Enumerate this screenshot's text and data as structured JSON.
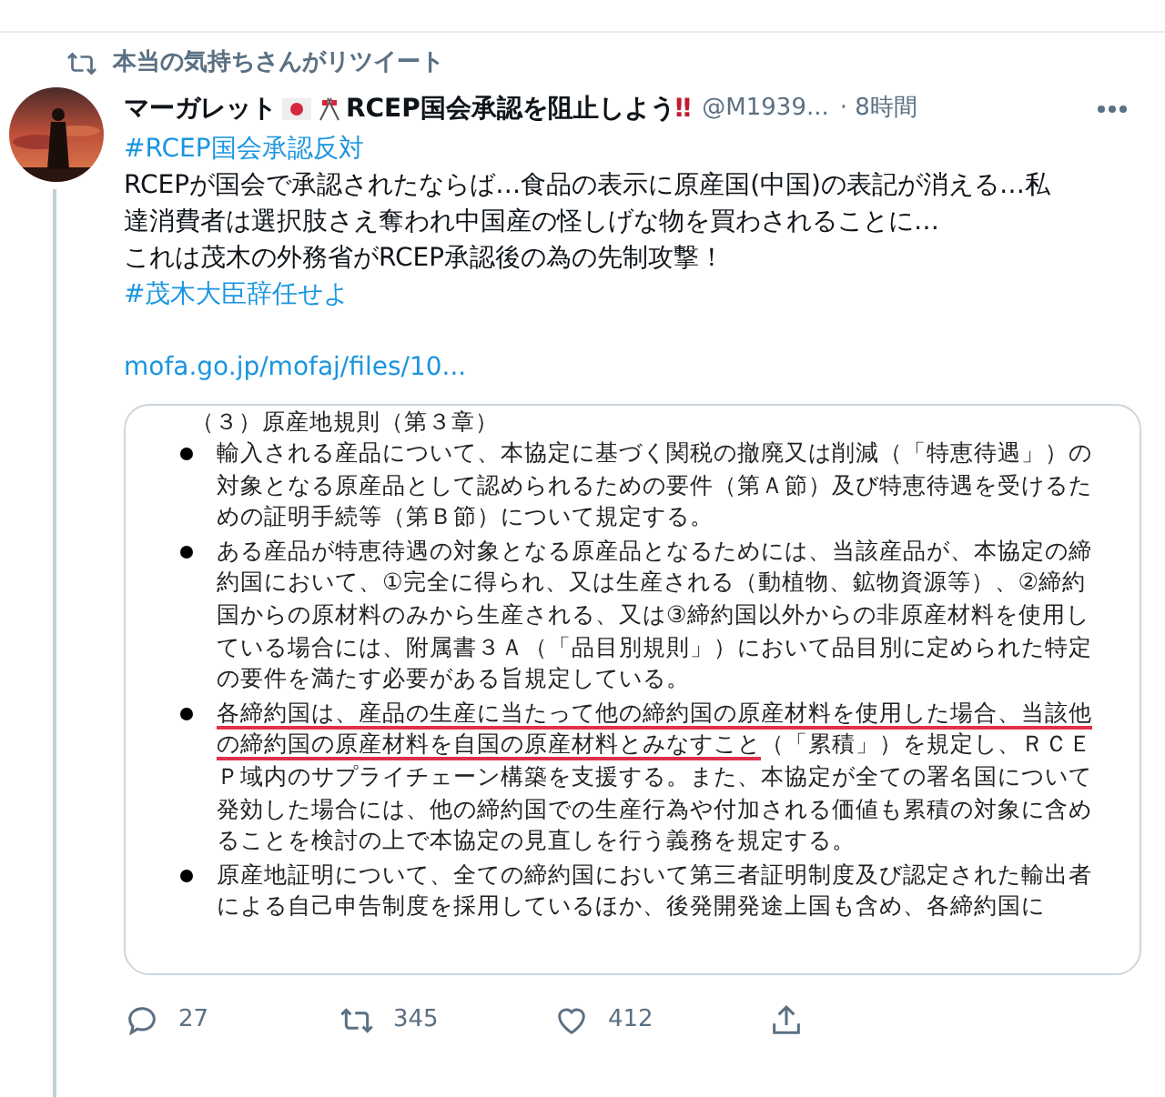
{
  "retweet_banner": {
    "text": "本当の気持ちさんがリツイート"
  },
  "tweet": {
    "display_name": "マーガレット",
    "name_suffix": "RCEP国会承認を阻止しよう",
    "name_emphasis": "‼",
    "handle": "@M1939...",
    "time": "· 8時間",
    "body": [
      {
        "kind": "hashtag",
        "text": "#RCEP国会承認反対"
      },
      {
        "kind": "text",
        "text": "RCEPが国会で承認されたならば…食品の表示に原産国(中国)の表記が消える…私達消費者は選択肢さえ奪われ中国産の怪しげな物を買わされることに…"
      },
      {
        "kind": "text",
        "text": "これは茂木の外務省がRCEP承認後の為の先制攻撃！"
      },
      {
        "kind": "hashtag",
        "text": "#茂木大臣辞任せよ"
      },
      {
        "kind": "blank"
      },
      {
        "kind": "link",
        "text": "mofa.go.jp/mofaj/files/10..."
      }
    ]
  },
  "document": {
    "heading": "（３）原産地規則（第３章）",
    "bullets": [
      {
        "segments": [
          {
            "text": "輸入される産品について、本協定に基づく関税の撤廃又は削減（「特恵待遇」）の対象となる原産品として認められるための要件（第Ａ節）及び特恵待遇を受けるための証明手続等（第Ｂ節）について規定する。",
            "underlined": false
          }
        ]
      },
      {
        "segments": [
          {
            "text": "ある産品が特恵待遇の対象となる原産品となるためには、当該産品が、本協定の締約国において、①完全に得られ、又は生産される（動植物、鉱物資源等）、②締約国からの原材料のみから生産される、又は③締約国以外からの非原産材料を使用している場合には、附属書３Ａ（「品目別規則」）において品目別に定められた特定の要件を満たす必要がある旨規定している。",
            "underlined": false
          }
        ]
      },
      {
        "segments": [
          {
            "text": "各締約国は、産品の生産に当たって他の締約国の原産材料を使用した場合、当該他の締約国の原産材料を自国の原産材料とみなすこと",
            "underlined": true
          },
          {
            "text": "（「累積」）を規定し、ＲＣＥＰ域内のサプライチェーン構築を支援する。また、本協定が全ての署名国について発効した場合には、他の締約国での生産行為や付加される価値も累積の対象に含めることを検討の上で本協定の見直しを行う義務を規定する。",
            "underlined": false
          }
        ]
      },
      {
        "segments": [
          {
            "text": "原産地証明について、全ての締約国において第三者証明制度及び認定された輸出者による自己申告制度を採用しているほか、後発開発途上国も含め、各締約国に",
            "underlined": false
          }
        ]
      }
    ]
  },
  "actions": [
    {
      "kind": "reply",
      "count": "27"
    },
    {
      "kind": "retweet",
      "count": "345"
    },
    {
      "kind": "like",
      "count": "412"
    },
    {
      "kind": "share"
    }
  ]
}
